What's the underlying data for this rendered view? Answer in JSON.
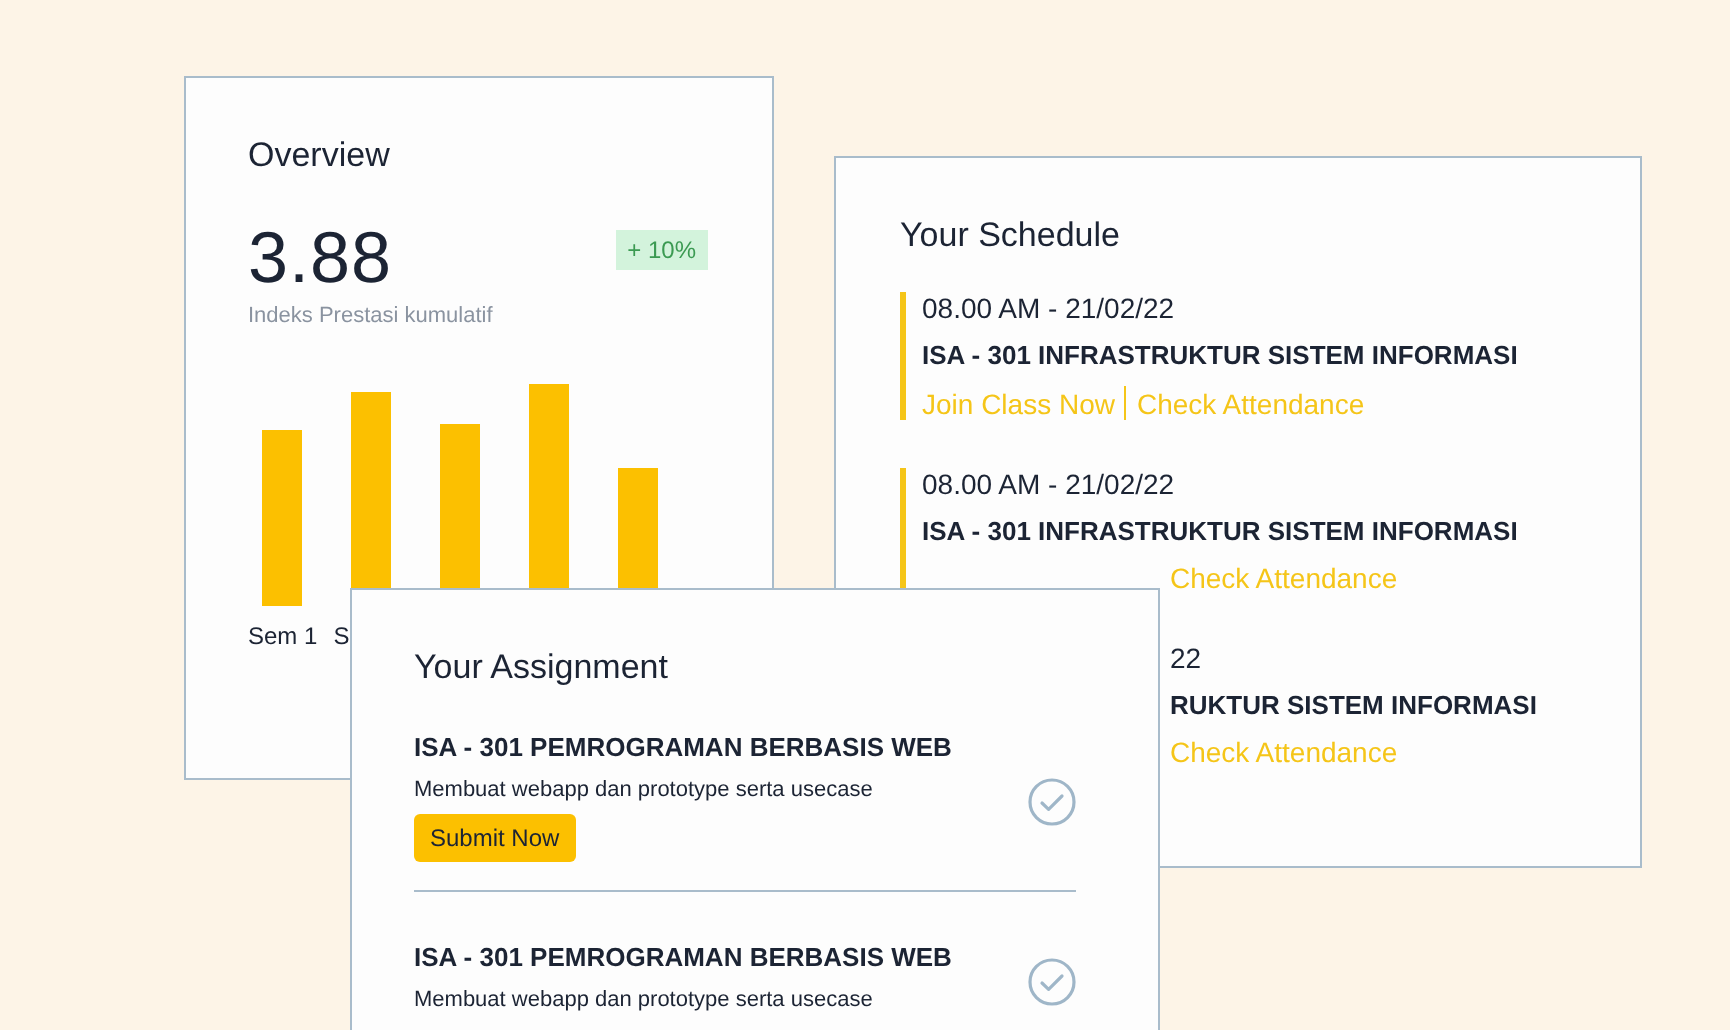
{
  "overview": {
    "title": "Overview",
    "score": "3.88",
    "change": "+ 10%",
    "caption": "Indeks Prestasi kumulatif",
    "bar_labels": [
      "Sem 1",
      "S"
    ]
  },
  "schedule": {
    "title": "Your Schedule",
    "items": [
      {
        "kind": "full",
        "time": "08.00 AM - 21/02/22",
        "course": "ISA - 301 INFRASTRUKTUR SISTEM INFORMASI",
        "links": [
          "Join Class Now",
          "Check Attendance"
        ]
      },
      {
        "kind": "links-hidden",
        "time": "08.00 AM - 21/02/22",
        "course": "ISA - 301 INFRASTRUKTUR SISTEM INFORMASI",
        "links": [
          "Check Attendance"
        ]
      },
      {
        "kind": "left-hidden",
        "time": "22",
        "course": "RUKTUR SISTEM INFORMASI",
        "links": [
          "Check Attendance"
        ]
      }
    ]
  },
  "assignment": {
    "title": "Your Assignment",
    "items": [
      {
        "course": "ISA - 301 PEMROGRAMAN BERBASIS WEB",
        "description": "Membuat webapp dan prototype serta usecase",
        "button": "Submit Now"
      },
      {
        "course": "ISA - 301 PEMROGRAMAN BERBASIS WEB",
        "description": "Membuat webapp dan prototype serta usecase"
      }
    ]
  }
}
